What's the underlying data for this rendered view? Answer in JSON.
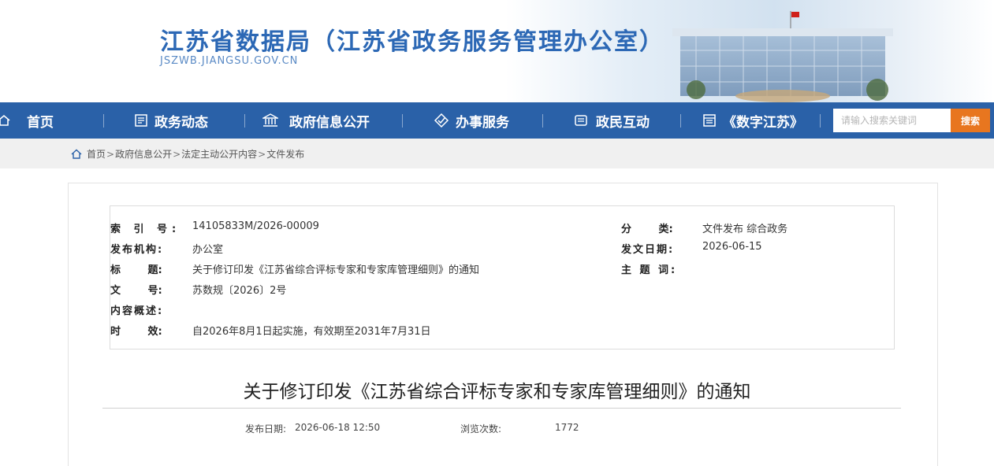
{
  "header": {
    "title": "江苏省数据局（江苏省政务服务管理办公室）",
    "domain": "JSZWB.JIANGSU.GOV.CN"
  },
  "nav": {
    "items": [
      {
        "label": "首页",
        "icon": "home-icon"
      },
      {
        "label": "政务动态",
        "icon": "news-icon"
      },
      {
        "label": "政府信息公开",
        "icon": "government-building-icon"
      },
      {
        "label": "办事服务",
        "icon": "service-badge-icon"
      },
      {
        "label": "政民互动",
        "icon": "interaction-icon"
      },
      {
        "label": "《数字江苏》",
        "icon": "magazine-icon"
      }
    ],
    "search_placeholder": "请输入搜索关键词",
    "search_button": "搜索",
    "color": "#2a61a8",
    "search_button_color": "#e8761f"
  },
  "breadcrumb": {
    "items": [
      "首页",
      "政府信息公开",
      "法定主动公开内容",
      "文件发布"
    ],
    "separator": ">"
  },
  "meta": {
    "index_label": "索 引 号:",
    "index_value": "14105833M/2026-00009",
    "org_label": "发布机构:",
    "org_value": "办公室",
    "title_label": "标 题:",
    "title_value": "关于修订印发《江苏省综合评标专家和专家库管理细则》的通知",
    "doc_no_label": "文 号:",
    "doc_no_value": "苏数规〔2026〕2号",
    "summary_label": "内容概述:",
    "summary_value": "",
    "validity_label": "时 效:",
    "validity_value": "自2026年8月1日起实施，有效期至2031年7月31日",
    "category_label": "分 类:",
    "category_value": "文件发布 综合政务",
    "issue_date_label": "发文日期:",
    "issue_date_value": "2026-06-15",
    "keywords_label": "主 题 词:",
    "keywords_value": ""
  },
  "document": {
    "title": "关于修订印发《江苏省综合评标专家和专家库管理细则》的通知",
    "publish_label": "发布日期:",
    "publish_value": "2026-06-18 12:50",
    "views_label": "浏览次数:",
    "views_value": "1772"
  }
}
